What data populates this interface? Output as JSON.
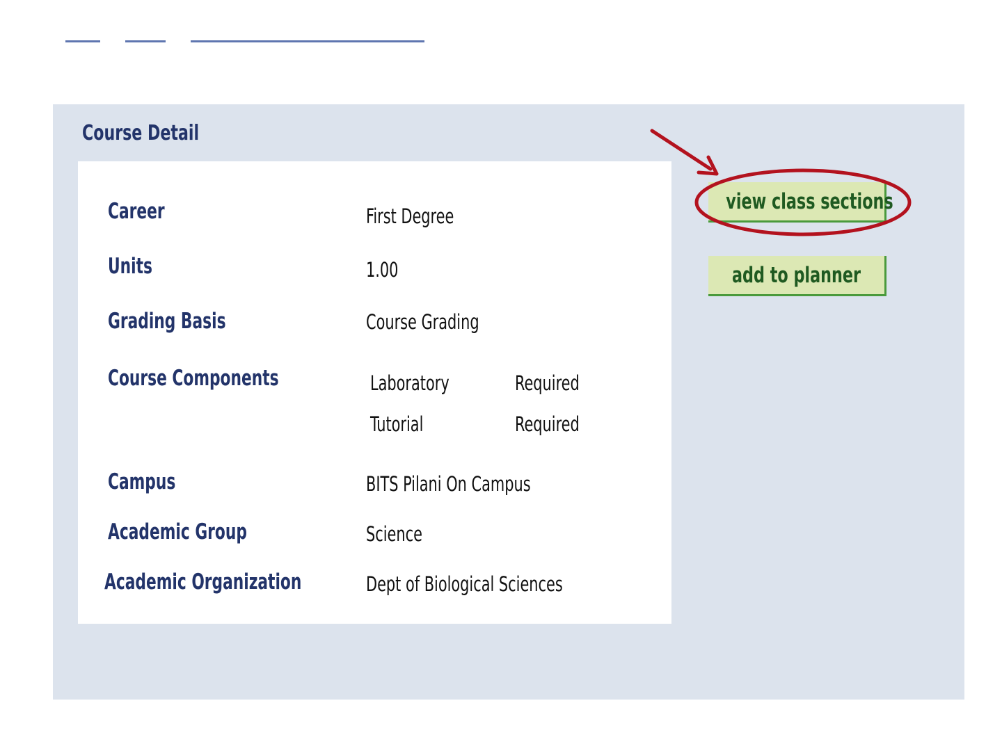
{
  "panel": {
    "title": "Course Detail"
  },
  "details": {
    "career": {
      "label": "Career",
      "value": "First Degree"
    },
    "units": {
      "label": "Units",
      "value": "1.00"
    },
    "grading_basis": {
      "label": "Grading Basis",
      "value": "Course Grading"
    },
    "components": {
      "label": "Course Components",
      "items": [
        {
          "name": "Laboratory",
          "status": "Required"
        },
        {
          "name": "Tutorial",
          "status": "Required"
        }
      ]
    },
    "campus": {
      "label": "Campus",
      "value": "BITS Pilani On Campus"
    },
    "academic_group": {
      "label": "Academic Group",
      "value": "Science"
    },
    "academic_org": {
      "label": "Academic Organization",
      "value": "Dept of Biological Sciences"
    }
  },
  "actions": {
    "view_class_sections": "view class sections",
    "add_to_planner": "add to planner"
  },
  "colors": {
    "panel_background": "#dce3ed",
    "label_text": "#23346a",
    "button_background": "#dce8b4",
    "button_text": "#1f5a21",
    "annotation_red": "#b3121e"
  },
  "annotations": {
    "highlight": "view-class-sections-button",
    "shapes": [
      "arrow",
      "ellipse"
    ]
  }
}
